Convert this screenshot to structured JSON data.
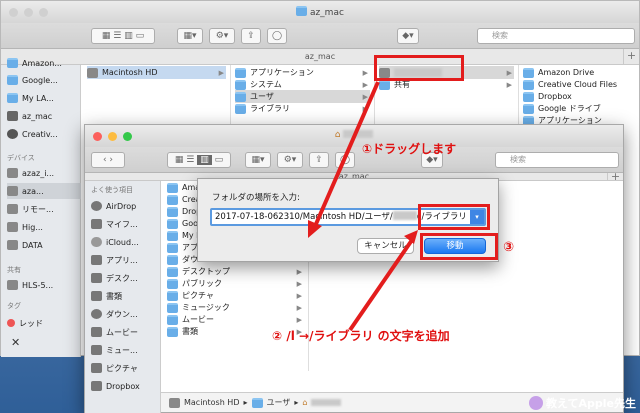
{
  "back_window": {
    "title": "az_mac",
    "path_title": "az_mac",
    "search_placeholder": "検索",
    "sidebar": {
      "items_top": [
        "Amazon...",
        "Google...",
        "My LA...",
        "az_mac",
        "Creativ..."
      ],
      "devices_header": "デバイス",
      "devices": [
        "azaz_i...",
        "aza...",
        "リモー...",
        "Hig...",
        "DATA"
      ],
      "shared_header": "共有",
      "shared": [
        "HLS-5..."
      ],
      "tags_header": "タグ",
      "tags": [
        "レッド"
      ]
    },
    "col1": [
      "Macintosh HD"
    ],
    "col2": [
      "アプリケーション",
      "システム",
      "ユーザ",
      "ライブラリ"
    ],
    "col3": [
      "共有"
    ],
    "col4": [
      "Amazon Drive",
      "Creative Cloud Files",
      "Dropbox",
      "Google ドライブ",
      "アプリケーション"
    ]
  },
  "front_window": {
    "path_title": "az_mac",
    "search_placeholder": "検索",
    "sidebar": {
      "header": "よく使う項目",
      "items": [
        "AirDrop",
        "マイフ...",
        "iCloud...",
        "アプリ...",
        "デスク...",
        "書類",
        "ダウン...",
        "ムービー",
        "ミュー...",
        "ピクチャ",
        "Dropbox"
      ]
    },
    "col1": [
      "Ama",
      "Crea",
      "Drop",
      "Goo",
      "My L",
      "アプ",
      "ダウ",
      "デスクトップ",
      "パブリック",
      "ピクチャ",
      "ミュージック",
      "ムービー",
      "書類"
    ],
    "statusbar": {
      "disk": "Macintosh HD",
      "users": "ユーザ"
    }
  },
  "dialog": {
    "label": "フォルダの場所を入力:",
    "path_value": "2017-07-18-062310/Macintosh HD/ユーザ/",
    "path_suffix": "c/ライブラリ",
    "cancel": "キャンセル",
    "move": "移動"
  },
  "annotations": {
    "step1": "①ドラッグします",
    "step2": "② /l →/ライブラリ の文字を追加",
    "step3": "③"
  },
  "watermark": "教えてApple先生",
  "colors": {
    "annotation_red": "#e31d1d",
    "selection_blue": "#1a78f0",
    "folder_blue": "#69aee8"
  }
}
